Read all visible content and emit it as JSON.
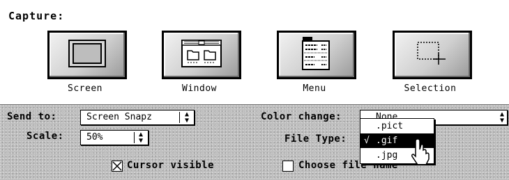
{
  "capture": {
    "title": "Capture:",
    "buttons": [
      {
        "label": "Screen",
        "icon": "screen-icon"
      },
      {
        "label": "Window",
        "icon": "window-icon"
      },
      {
        "label": "Menu",
        "icon": "menu-icon"
      },
      {
        "label": "Selection",
        "icon": "selection-icon"
      }
    ]
  },
  "options": {
    "send_to": {
      "label": "Send to:",
      "value": "Screen Snapz"
    },
    "scale": {
      "label": "Scale:",
      "value": "50%"
    },
    "color_change": {
      "label": "Color change:",
      "value": "None"
    },
    "file_type": {
      "label": "File Type:",
      "value": ".gif"
    },
    "cursor_visible": {
      "label": "Cursor visible",
      "checked": true
    },
    "choose_file_name": {
      "label": "Choose file name",
      "checked": false
    }
  },
  "file_type_menu": {
    "items": [
      {
        "label": ".pict",
        "checked": false,
        "highlighted": false
      },
      {
        "label": ".gif",
        "checked": true,
        "highlighted": true
      },
      {
        "label": ".jpg",
        "checked": false,
        "highlighted": false
      }
    ],
    "check_glyph": "√"
  },
  "colors": {
    "panel_gray": "#bcbcbc",
    "highlight": "#000000"
  }
}
